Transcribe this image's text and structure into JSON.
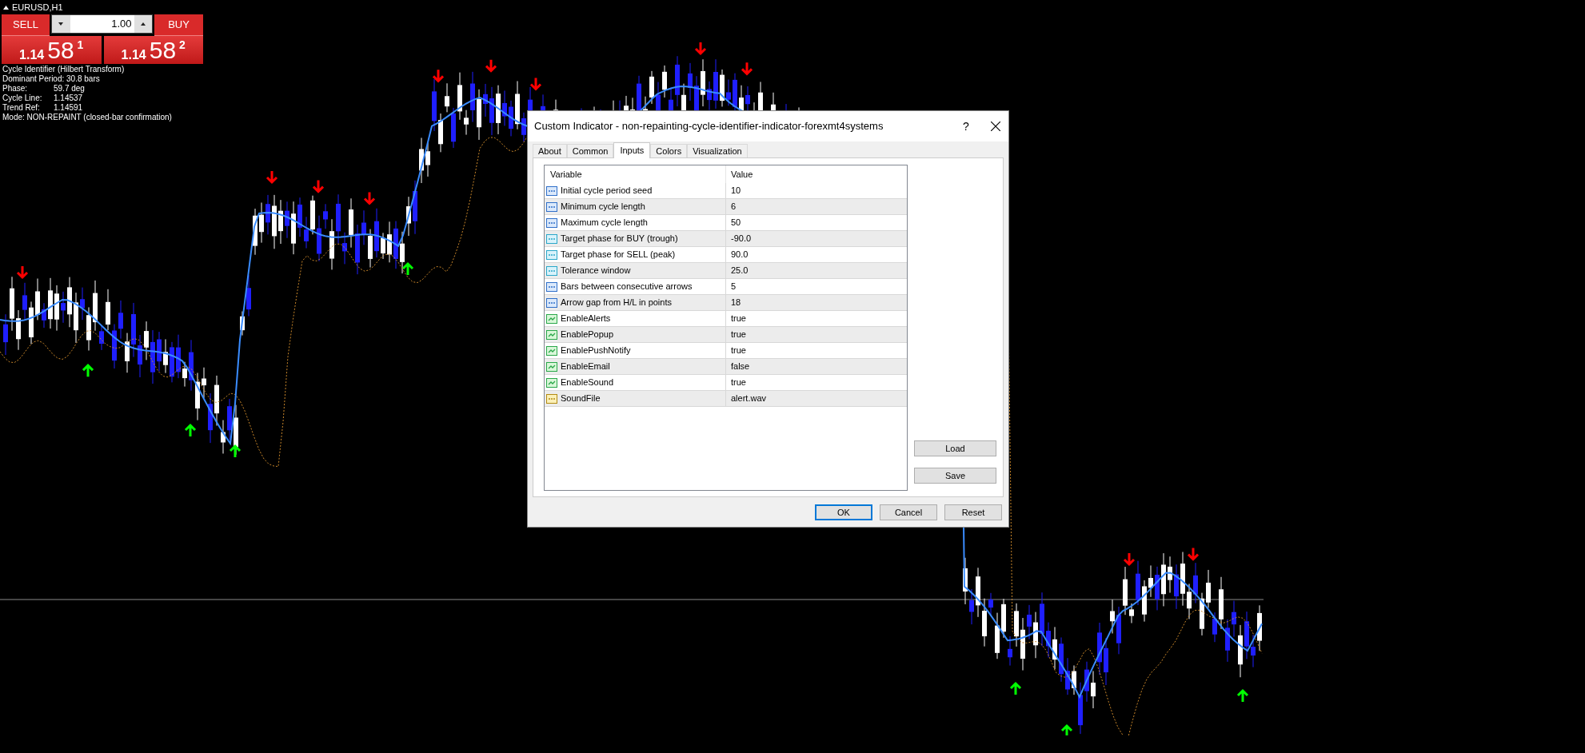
{
  "chart": {
    "symbol": "EURUSD,H1"
  },
  "trade_panel": {
    "sell_label": "SELL",
    "buy_label": "BUY",
    "lot": "1.00",
    "sell_price": {
      "big": "1.14",
      "pips": "58",
      "fraction": "1"
    },
    "buy_price": {
      "big": "1.14",
      "pips": "58",
      "fraction": "2"
    }
  },
  "info_lines": [
    {
      "label": "Cycle Identifier (Hilbert Transform)"
    },
    {
      "label": "Dominant Period: 30.8 bars"
    },
    {
      "label": "Phase:",
      "value": "59.7 deg"
    },
    {
      "label": "Cycle Line:",
      "value": "1.14537"
    },
    {
      "label": "Trend Ref:",
      "value": "1.14591"
    },
    {
      "label": "Mode: NON-REPAINT (closed-bar confirmation)"
    }
  ],
  "dialog": {
    "title": "Custom Indicator - non-repainting-cycle-identifier-indicator-forexmt4systems",
    "help": "?",
    "tabs": [
      {
        "label": "About",
        "selected": false
      },
      {
        "label": "Common",
        "selected": false
      },
      {
        "label": "Inputs",
        "selected": true
      },
      {
        "label": "Colors",
        "selected": false
      },
      {
        "label": "Visualization",
        "selected": false
      }
    ],
    "table": {
      "columns": [
        "Variable",
        "Value"
      ],
      "rows": [
        {
          "kind": "int",
          "variable": "Initial cycle period seed",
          "value": "10"
        },
        {
          "kind": "int",
          "variable": "Minimum cycle length",
          "value": "6"
        },
        {
          "kind": "int",
          "variable": "Maximum cycle length",
          "value": "50"
        },
        {
          "kind": "double",
          "variable": "Target phase for BUY (trough)",
          "value": "-90.0"
        },
        {
          "kind": "double",
          "variable": "Target phase for SELL (peak)",
          "value": "90.0"
        },
        {
          "kind": "double",
          "variable": "Tolerance window",
          "value": "25.0"
        },
        {
          "kind": "int",
          "variable": "Bars between consecutive arrows",
          "value": "5"
        },
        {
          "kind": "int",
          "variable": "Arrow gap from H/L in points",
          "value": "18"
        },
        {
          "kind": "bool",
          "variable": "EnableAlerts",
          "value": "true"
        },
        {
          "kind": "bool",
          "variable": "EnablePopup",
          "value": "true"
        },
        {
          "kind": "bool",
          "variable": "EnablePushNotify",
          "value": "true"
        },
        {
          "kind": "bool",
          "variable": "EnableEmail",
          "value": "false"
        },
        {
          "kind": "bool",
          "variable": "EnableSound",
          "value": "true"
        },
        {
          "kind": "string",
          "variable": "SoundFile",
          "value": "alert.wav"
        }
      ]
    },
    "side_buttons": [
      "Load",
      "Save"
    ],
    "buttons": [
      {
        "label": "OK",
        "default": true
      },
      {
        "label": "Cancel",
        "default": false
      },
      {
        "label": "Reset",
        "default": false
      }
    ]
  }
}
